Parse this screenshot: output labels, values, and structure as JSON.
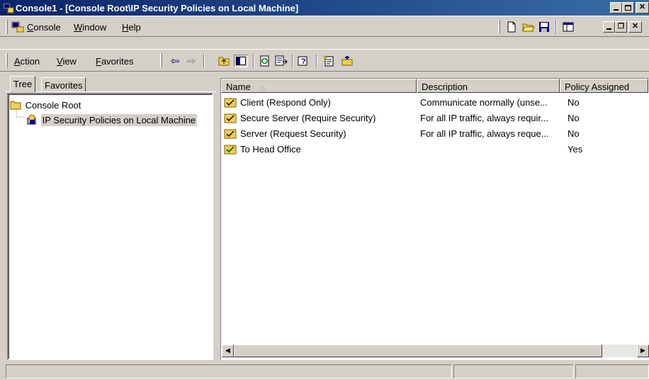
{
  "window": {
    "title": "Console1 - [Console Root\\IP Security Policies on Local Machine]",
    "accent": "#0a246a",
    "caption_buttons": [
      "minimize",
      "maximize",
      "close"
    ]
  },
  "main_menu": {
    "items": [
      {
        "label": "Console",
        "underline": "C"
      },
      {
        "label": "Window",
        "underline": "W"
      },
      {
        "label": "Help",
        "underline": "H"
      }
    ],
    "right_icons": [
      "new-icon",
      "open-folder-icon",
      "save-icon",
      "console-tree-icon"
    ],
    "mdi_buttons": [
      "minimize",
      "restore",
      "close"
    ]
  },
  "action_menu": {
    "items": [
      {
        "label": "Action",
        "underline": "A"
      },
      {
        "label": "View",
        "underline": "V"
      },
      {
        "label": "Favorites",
        "underline": "F"
      }
    ],
    "toolbar_icons": [
      "back-arrow-icon",
      "forward-arrow-icon",
      "up-one-level-icon",
      "show-hide-tree-icon",
      "refresh-icon",
      "export-list-icon",
      "help-icon",
      "create-policy-icon",
      "manage-filters-icon"
    ]
  },
  "tabs": [
    {
      "label": "Tree",
      "active": true
    },
    {
      "label": "Favorites",
      "active": false
    }
  ],
  "tree": {
    "root": "Console Root",
    "child": "IP Security Policies on Local Machine"
  },
  "columns": [
    "Name",
    "Description",
    "Policy Assigned"
  ],
  "policies": [
    {
      "name": "Client (Respond Only)",
      "description": "Communicate normally (unse...",
      "assigned": "No"
    },
    {
      "name": "Secure Server (Require Security)",
      "description": "For all IP traffic, always requir...",
      "assigned": "No"
    },
    {
      "name": "Server (Request Security)",
      "description": "For all IP traffic, always reque...",
      "assigned": "No"
    },
    {
      "name": "To Head Office",
      "description": "",
      "assigned": "Yes"
    }
  ],
  "status_bar": {
    "cells": [
      "",
      "",
      ""
    ]
  }
}
